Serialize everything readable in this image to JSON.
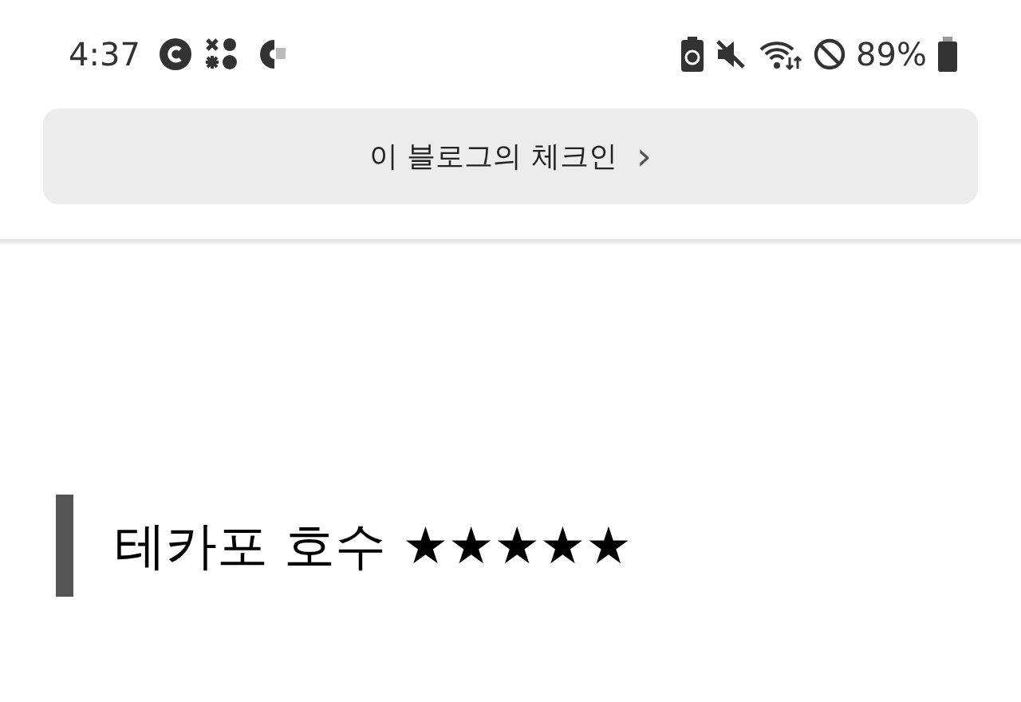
{
  "status_bar": {
    "time": "4:37",
    "battery": "89%"
  },
  "checkin": {
    "label": "이 블로그의 체크인",
    "chevron": "›"
  },
  "heading": {
    "text": "테카포 호수 ★★★★★"
  }
}
